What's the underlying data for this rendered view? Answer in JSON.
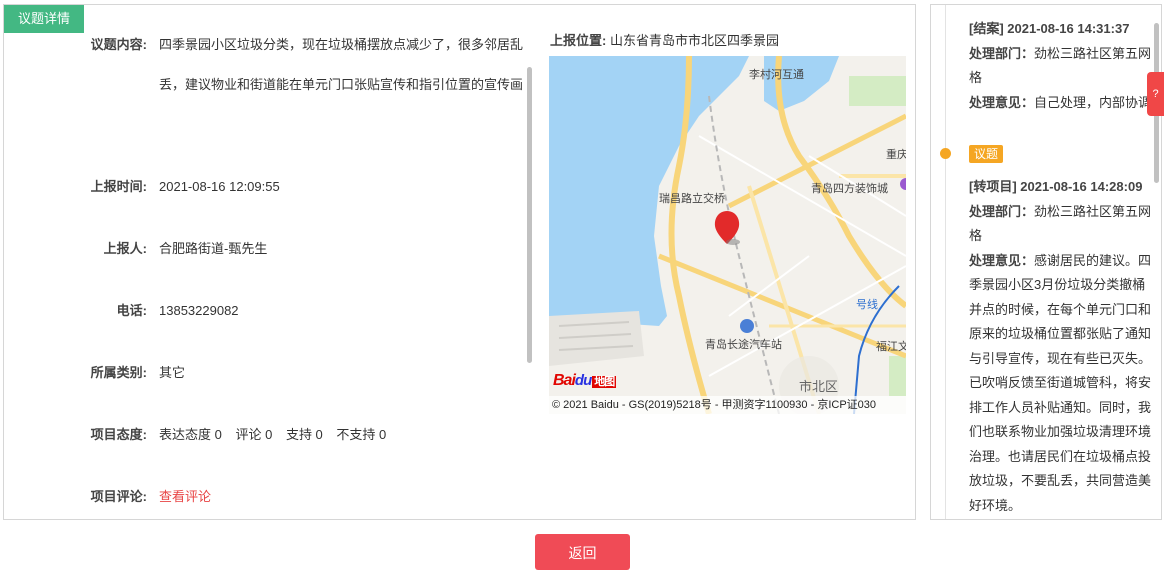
{
  "tag": "议题详情",
  "fields": {
    "content": {
      "label": "议题内容:",
      "value": "四季景园小区垃圾分类，现在垃圾桶摆放点减少了，很多邻居乱丢，建议物业和街道能在单元门口张贴宣传和指引位置的宣传画"
    },
    "time": {
      "label": "上报时间:",
      "value": "2021-08-16 12:09:55"
    },
    "reporter": {
      "label": "上报人:",
      "value": "合肥路街道-甄先生"
    },
    "phone": {
      "label": "电话:",
      "value": "13853229082"
    },
    "category": {
      "label": "所属类别:",
      "value": "其它"
    },
    "attitude": {
      "label": "项目态度:",
      "items": [
        "表达态度 0",
        "评论 0",
        "支持 0",
        "不支持 0"
      ]
    },
    "comment": {
      "label": "项目评论:",
      "link": "查看评论"
    }
  },
  "location": {
    "label": "上报位置:",
    "value": "山东省青岛市市北区四季景园"
  },
  "map": {
    "labels": {
      "licun": "李村河互通",
      "ruichang": "瑞昌路立交桥",
      "sifang": "青岛四方装饰城",
      "zhongqing": "重庆",
      "station": "青岛长途汽车站",
      "shibei": "市北区",
      "fujiang": "福江文",
      "line": "号线"
    },
    "logo_text": "Bai",
    "logo_paw": "du",
    "logo_ditu": "地图",
    "credit": "© 2021 Baidu - GS(2019)5218号 - 甲测资字1100930 - 京ICP证030"
  },
  "timeline": {
    "entry1": {
      "status": "[结案] 2021-08-16 14:31:37",
      "dept_label": "处理部门：",
      "dept": "劲松三路社区第五网格",
      "opinion_label": "处理意见：",
      "opinion": "自己处理，内部协调"
    },
    "entry2": {
      "badge": "议题",
      "status": "[转项目] 2021-08-16 14:28:09",
      "dept_label": "处理部门：",
      "dept": "劲松三路社区第五网格",
      "opinion_label": "处理意见：",
      "opinion": "感谢居民的建议。四季景园小区3月份垃圾分类撤桶并点的时候，在每个单元门口和原来的垃圾桶位置都张贴了通知与引导宣传，现在有些已灭失。已吹哨反馈至街道城管科，将安排工作人员补贴通知。同时，我们也联系物业加强垃圾清理环境治理。也请居民们在垃圾桶点投放垃圾，不要乱丢，共同营造美好环境。"
    }
  },
  "side_tab": "?",
  "back_button": "返回",
  "colors": {
    "green": "#43b883",
    "orange": "#f5a623",
    "red": "#f04b56"
  }
}
